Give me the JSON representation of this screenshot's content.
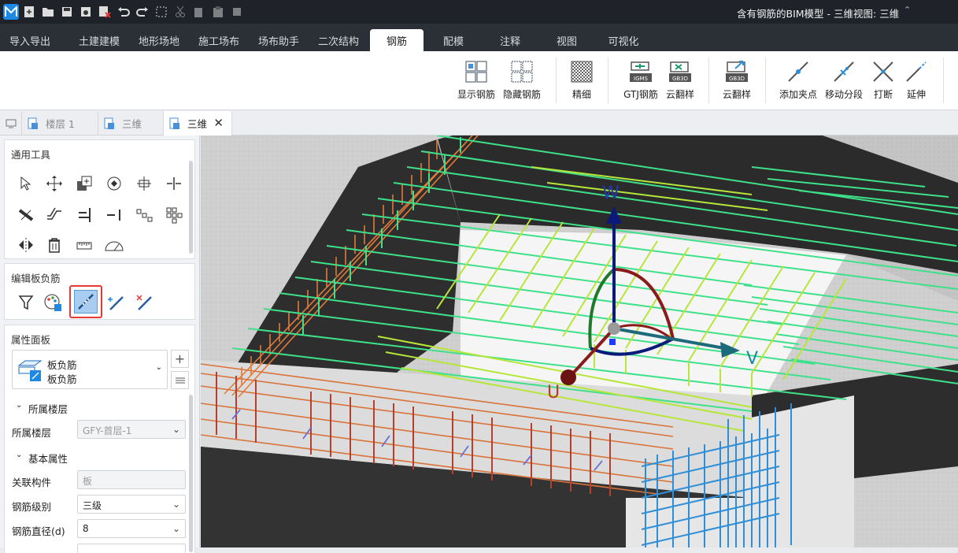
{
  "window": {
    "title": "含有钢筋的BIM模型 - 三维视图: 三维"
  },
  "quick_access": [
    "app-logo-icon",
    "new-file-icon",
    "open-folder-icon",
    "save-icon",
    "save-as-icon",
    "close-file-icon",
    "undo-icon",
    "redo-icon",
    "select-icon",
    "cut-icon",
    "copy-icon",
    "paste-icon",
    "layers-icon"
  ],
  "ribbon_tabs": [
    {
      "label": "导入导出"
    },
    {
      "label": "土建建模"
    },
    {
      "label": "地形场地"
    },
    {
      "label": "施工场布"
    },
    {
      "label": "场布助手"
    },
    {
      "label": "二次结构"
    },
    {
      "label": "钢筋"
    },
    {
      "label": "配模"
    },
    {
      "label": "注释"
    },
    {
      "label": "视图"
    },
    {
      "label": "可视化"
    }
  ],
  "active_tab": "钢筋",
  "ribbon_buttons": {
    "show_rebar": "显示钢筋",
    "hide_rebar": "隐藏钢筋",
    "fine": "精细",
    "gtj_rebar": "GTJ钢筋",
    "cloud_sample": "云翻样",
    "cloud_sample2": "云翻样",
    "add_point": "添加夹点",
    "move_segment": "移动分段",
    "break": "打断",
    "extend": "延伸"
  },
  "ribbon_icon_text": {
    "gtj": "IGMS",
    "gb3d": "GB3D"
  },
  "doc_tabs": [
    {
      "label": "楼层 1",
      "active": false
    },
    {
      "label": "三维",
      "active": false
    },
    {
      "label": "三维",
      "active": true
    }
  ],
  "left_panel": {
    "general_tools_title": "通用工具",
    "edit_title": "编辑板负筋",
    "properties_title": "属性面板",
    "type_line1": "板负筋",
    "type_line2": "板负筋",
    "group_floor": "所属楼层",
    "floor_label": "所属楼层",
    "floor_value": "GFY-首层-1",
    "group_basic": "基本属性",
    "assoc_label": "关联构件",
    "assoc_value": "板",
    "grade_label": "钢筋级别",
    "grade_value": "三级",
    "dia_label": "钢筋直径(d)",
    "dia_value": "8"
  },
  "gizmo": {
    "w": "W",
    "v": "V",
    "u": "U"
  },
  "colors": {
    "titlebar": "#1f2329",
    "tabbar": "#2b3037",
    "rebar_green": "#3fe08a",
    "rebar_yellow": "#b7e63a",
    "rebar_orange": "#e07b3a",
    "rebar_blue": "#2e8fd8",
    "highlight": "#e53935"
  }
}
